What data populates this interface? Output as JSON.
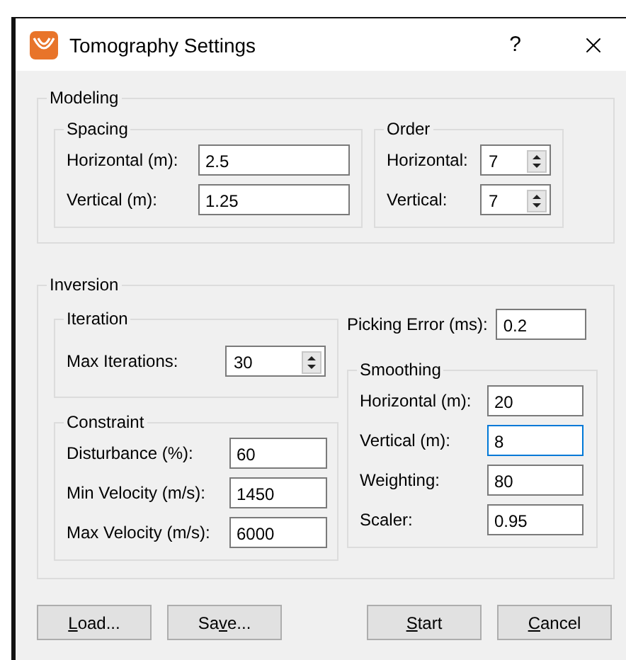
{
  "window": {
    "title": "Tomography Settings",
    "help": "?"
  },
  "modeling": {
    "title": "Modeling",
    "spacing": {
      "title": "Spacing",
      "fields": [
        {
          "label": "Horizontal (m):",
          "value": "2.5"
        },
        {
          "label": "Vertical (m):",
          "value": "1.25"
        }
      ]
    },
    "order": {
      "title": "Order",
      "fields": [
        {
          "label": "Horizontal:",
          "value": "7"
        },
        {
          "label": "Vertical:",
          "value": "7"
        }
      ]
    }
  },
  "inversion": {
    "title": "Inversion",
    "iteration": {
      "title": "Iteration",
      "fields": [
        {
          "label": "Max Iterations:",
          "value": "30"
        }
      ]
    },
    "picking_error": {
      "label": "Picking Error (ms):",
      "value": "0.2"
    },
    "constraint": {
      "title": "Constraint",
      "fields": [
        {
          "label": "Disturbance (%):",
          "value": "60"
        },
        {
          "label": "Min Velocity (m/s):",
          "value": "1450"
        },
        {
          "label": "Max Velocity (m/s):",
          "value": "6000"
        }
      ]
    },
    "smoothing": {
      "title": "Smoothing",
      "fields": [
        {
          "label": "Horizontal (m):",
          "value": "20",
          "focused": false
        },
        {
          "label": "Vertical (m):",
          "value": "8",
          "focused": true
        },
        {
          "label": "Weighting:",
          "value": "80",
          "focused": false
        },
        {
          "label": "Scaler:",
          "value": "0.95",
          "focused": false
        }
      ]
    }
  },
  "buttons": [
    {
      "key": "L",
      "post": "oad..."
    },
    {
      "pre": "Sa",
      "key": "v",
      "post": "e..."
    },
    {
      "key": "S",
      "post": "tart"
    },
    {
      "key": "C",
      "post": "ancel"
    }
  ]
}
